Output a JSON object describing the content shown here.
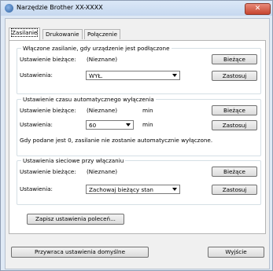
{
  "window": {
    "title": "Narzędzie Brother XX-XXXX",
    "close_label": "✕"
  },
  "tabs": [
    {
      "label": "Zasilanie"
    },
    {
      "label": "Drukowanie"
    },
    {
      "label": "Połączenie"
    }
  ],
  "power_on": {
    "legend": "Włączone zasilanie, gdy urządzenie jest podłączone",
    "current_label": "Ustawienie bieżące:",
    "current_value": "(Nieznane)",
    "current_button": "Bieżące",
    "setting_label": "Ustawienia:",
    "setting_value": "WYŁ.",
    "apply_button": "Zastosuj"
  },
  "auto_off": {
    "legend": "Ustawienie czasu automatycznego wyłączenia",
    "current_label": "Ustawienie bieżące:",
    "current_value": "(Nieznane)",
    "current_unit": "min",
    "current_button": "Bieżące",
    "setting_label": "Ustawienia:",
    "setting_value": "60",
    "setting_unit": "min",
    "apply_button": "Zastosuj",
    "note": "Gdy podane jest 0, zasilanie nie zostanie automatycznie wyłączone."
  },
  "network": {
    "legend": "Ustawienia sieciowe przy włączaniu",
    "current_label": "Ustawienie bieżące:",
    "current_value": "(Nieznane)",
    "current_button": "Bieżące",
    "setting_label": "Ustawienia:",
    "setting_value": "Zachowaj bieżący stan",
    "apply_button": "Zastosuj"
  },
  "save_button": "Zapisz ustawienia poleceń...",
  "restore_button": "Przywraca ustawienia domyślne",
  "exit_button": "Wyjście"
}
